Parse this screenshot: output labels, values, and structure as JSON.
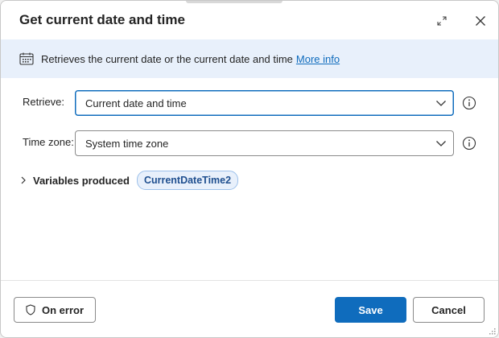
{
  "dialog": {
    "title": "Get current date and time",
    "expand_icon": "expand-icon",
    "close_icon": "close-icon"
  },
  "info_bar": {
    "icon": "calendar-icon",
    "text": "Retrieves the current date or the current date and time",
    "link": "More info"
  },
  "fields": {
    "retrieve": {
      "label": "Retrieve:",
      "value": "Current date and time",
      "help_icon": "info-circle-icon"
    },
    "timezone": {
      "label": "Time zone:",
      "value": "System time zone",
      "help_icon": "info-circle-icon"
    }
  },
  "variables": {
    "label": "Variables produced",
    "items": [
      "CurrentDateTime2"
    ]
  },
  "footer": {
    "on_error": "On error",
    "save": "Save",
    "cancel": "Cancel"
  },
  "colors": {
    "accent": "#0f6cbd",
    "info_bg": "#e8f0fb",
    "pill_text": "#1f4f8f"
  }
}
